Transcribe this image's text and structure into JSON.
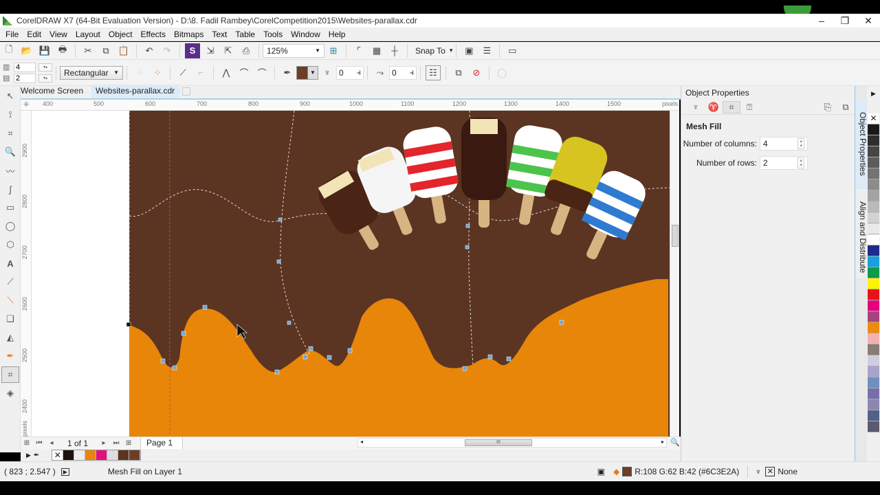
{
  "window": {
    "title": "CorelDRAW X7 (64-Bit Evaluation Version) - D:\\8. Fadil Rambey\\CorelCompetition2015\\Websites-parallax.cdr",
    "minimize": "–",
    "restore": "❐",
    "close": "✕"
  },
  "menu": [
    "File",
    "Edit",
    "View",
    "Layout",
    "Object",
    "Effects",
    "Bitmaps",
    "Text",
    "Table",
    "Tools",
    "Window",
    "Help"
  ],
  "toolbar": {
    "zoom_level": "125%",
    "snap_to": "Snap To",
    "zoom_arrow": "▼",
    "snap_arrow": "▾"
  },
  "property_bar": {
    "columns": "4",
    "rows": "2",
    "selection_mode": "Rectangular",
    "transparency": "0",
    "smoothing": "0",
    "fill_color": "#6C3E2A"
  },
  "tabs": [
    {
      "label": "Welcome Screen"
    },
    {
      "label": "Websites-parallax.cdr"
    }
  ],
  "ruler": {
    "h_ticks": [
      "400",
      "500",
      "600",
      "700",
      "800",
      "900",
      "1000",
      "1100",
      "1200",
      "1300",
      "1400",
      "1500",
      "pixels"
    ],
    "v_ticks": [
      "2900",
      "2800",
      "2700",
      "2600",
      "2500",
      "2400"
    ],
    "v_unit": "pixels"
  },
  "page_nav": {
    "page_count": "1 of 1",
    "page_tab": "Page 1"
  },
  "doc_palette": [
    "none",
    "#1c1410",
    "#eeeeee",
    "#e8860a",
    "#e0117a",
    "#dddddd",
    "#5b3522",
    "#6C3E2A"
  ],
  "status": {
    "coords": "( 823  ; 2.547  )",
    "object_info": "Mesh Fill on Layer 1",
    "fill_info": "R:108 G:62 B:42 (#6C3E2A)",
    "outline_info": "None",
    "fill_color": "#6C3E2A"
  },
  "docker": {
    "title": "Object Properties",
    "section": "Mesh Fill",
    "columns_label": "Number of columns:",
    "columns_value": "4",
    "rows_label": "Number of rows:",
    "rows_value": "2"
  },
  "side_tabs": [
    "Object Properties",
    "Align and Distribute"
  ],
  "color_palette": [
    "none",
    "#1a1a1a",
    "#2e2e2e",
    "#454545",
    "#5c5c5c",
    "#747474",
    "#8c8c8c",
    "#a3a3a3",
    "#bababa",
    "#d2d2d2",
    "#e9e9e9",
    "#ffffff",
    "#1f2a8a",
    "#16a0dc",
    "#0f9a4a",
    "#fff200",
    "#e8141c",
    "#e6007e",
    "#a8437e",
    "#ef8a0a",
    "#f2b3b0",
    "#8a7c74",
    "#cfcde0",
    "#a7a4cc",
    "#6f8fc0",
    "#7670aa",
    "#8b87b0",
    "#52618a",
    "#5a5a6e"
  ],
  "canvas": {
    "background": "#5b3522",
    "orange": "#e8860a"
  }
}
